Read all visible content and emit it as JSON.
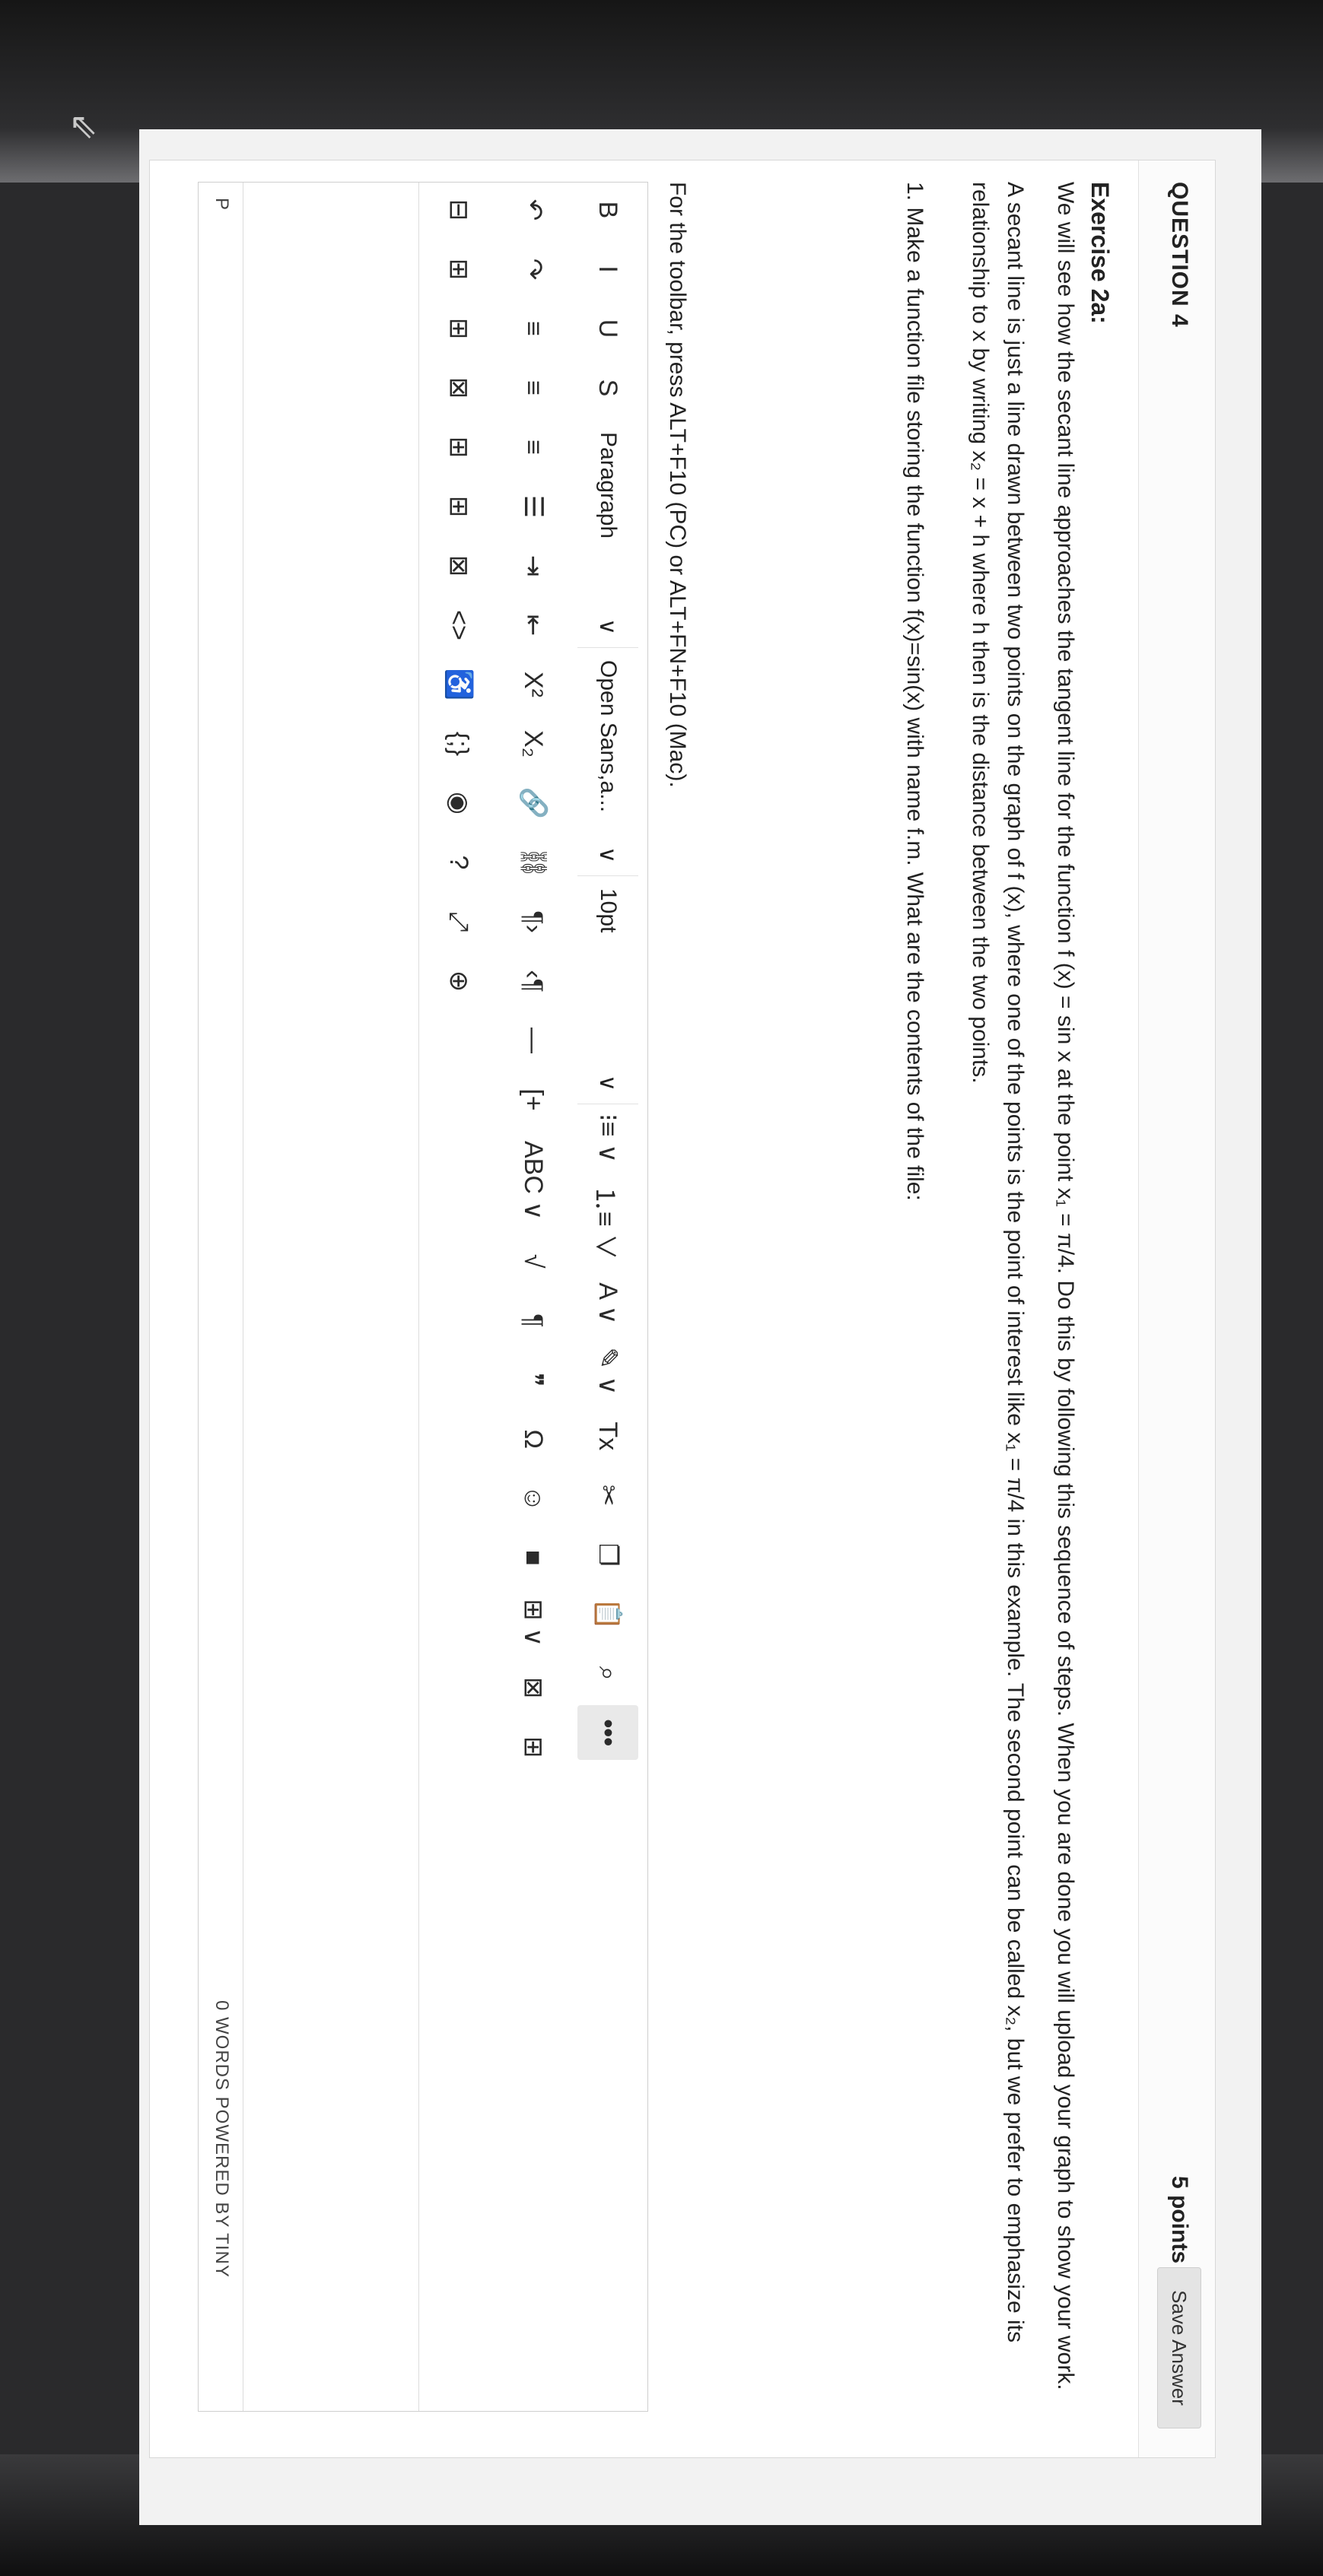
{
  "question": {
    "title": "QUESTION 4",
    "points": "5 points",
    "save_label": "Save Answer"
  },
  "exercise": {
    "title": "Exercise 2a:",
    "p1": "We will see how the secant line approaches the tangent line for the function f (x) = sin x at the point x₁ = π/4. Do this by following this sequence of steps. When you are done you will upload your graph to show your work.",
    "p2": "A secant line is just a line drawn between two points on the graph of f (x), where one of the points is the point of interest like x₁ = π/4 in this example. The second point can be called x₂, but we prefer to emphasize its relationship to x by writing x₂ = x + h where h then is the distance between the two points.",
    "step1": "1.  Make a function file storing the function f(x)=sin(x) with name f.m. What are the contents of the file:"
  },
  "editor": {
    "toolbar_hint": "For the toolbar, press ALT+F10 (PC) or ALT+FN+F10 (Mac).",
    "block_format": "Paragraph",
    "font_family": "Open Sans,a...",
    "font_size": "10pt",
    "path": "P",
    "word_count": "0 WORDS  POWERED BY TINY",
    "chevron": "∨"
  },
  "toolbar": {
    "row1": [
      {
        "name": "bold-button",
        "glyph": "B"
      },
      {
        "name": "italic-button",
        "glyph": "I"
      },
      {
        "name": "underline-button",
        "glyph": "U"
      },
      {
        "name": "strikethrough-button",
        "glyph": "S"
      }
    ],
    "row1_right": [
      {
        "name": "bullet-list-button",
        "glyph": "⁝≡ ∨"
      },
      {
        "name": "numbered-list-button",
        "glyph": "⒈≡ ∨"
      },
      {
        "name": "text-color-button",
        "glyph": "A ∨"
      },
      {
        "name": "highlight-color-button",
        "glyph": "✎ ∨"
      },
      {
        "name": "clear-formatting-button",
        "glyph": "Tx"
      },
      {
        "name": "cut-icon",
        "glyph": "✂"
      },
      {
        "name": "copy-icon",
        "glyph": "❐"
      },
      {
        "name": "paste-icon",
        "glyph": "📋"
      },
      {
        "name": "find-icon",
        "glyph": "⌕"
      },
      {
        "name": "more-button",
        "glyph": "•••"
      }
    ],
    "row2": [
      {
        "name": "undo-icon",
        "glyph": "↶"
      },
      {
        "name": "redo-icon",
        "glyph": "↷"
      },
      {
        "name": "align-left-icon",
        "glyph": "≡"
      },
      {
        "name": "align-center-icon",
        "glyph": "≡"
      },
      {
        "name": "align-right-icon",
        "glyph": "≡"
      },
      {
        "name": "align-justify-icon",
        "glyph": "☰"
      },
      {
        "name": "indent-icon",
        "glyph": "⇥"
      },
      {
        "name": "outdent-icon",
        "glyph": "⇤"
      },
      {
        "name": "superscript-icon",
        "glyph": "X²"
      },
      {
        "name": "subscript-icon",
        "glyph": "X₂"
      },
      {
        "name": "link-icon",
        "glyph": "🔗"
      },
      {
        "name": "unlink-icon",
        "glyph": "⛓"
      },
      {
        "name": "ltr-icon",
        "glyph": "¶›"
      },
      {
        "name": "rtl-icon",
        "glyph": "‹¶"
      },
      {
        "name": "horizontal-rule-icon",
        "glyph": "—"
      },
      {
        "name": "insert-placeholder-icon",
        "glyph": "[+"
      },
      {
        "name": "spellcheck-icon",
        "glyph": "ABC ∨"
      },
      {
        "name": "formula-icon",
        "glyph": "√"
      },
      {
        "name": "paragraph-mark-icon",
        "glyph": "¶"
      },
      {
        "name": "blockquote-icon",
        "glyph": "❞"
      },
      {
        "name": "special-char-icon",
        "glyph": "Ω"
      },
      {
        "name": "emoji-icon",
        "glyph": "☺"
      },
      {
        "name": "media-icon",
        "glyph": "■"
      },
      {
        "name": "table-icon",
        "glyph": "⊞ ∨"
      },
      {
        "name": "table-delete-icon",
        "glyph": "⊠"
      },
      {
        "name": "table-props-icon",
        "glyph": "⊞"
      }
    ],
    "row3": [
      {
        "name": "table-row-before-icon",
        "glyph": "⊟"
      },
      {
        "name": "table-row-after-icon",
        "glyph": "⊞"
      },
      {
        "name": "table-col-before-icon",
        "glyph": "⊞"
      },
      {
        "name": "table-delete-row-icon",
        "glyph": "⊠"
      },
      {
        "name": "table-col-after-icon",
        "glyph": "⊞"
      },
      {
        "name": "table-insert-col-icon",
        "glyph": "⊞"
      },
      {
        "name": "table-delete-col-icon",
        "glyph": "⊠"
      },
      {
        "name": "source-code-icon",
        "glyph": "<>"
      },
      {
        "name": "accessibility-icon",
        "glyph": "♿"
      },
      {
        "name": "code-sample-icon",
        "glyph": "{;}"
      },
      {
        "name": "preview-icon",
        "glyph": "◉"
      },
      {
        "name": "help-icon",
        "glyph": "?"
      },
      {
        "name": "fullscreen-icon",
        "glyph": "⤢"
      },
      {
        "name": "add-content-icon",
        "glyph": "⊕"
      }
    ]
  }
}
